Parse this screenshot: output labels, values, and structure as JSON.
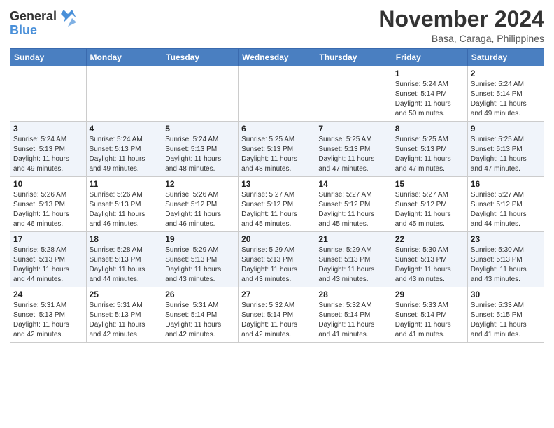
{
  "logo": {
    "line1": "General",
    "line2": "Blue"
  },
  "title": "November 2024",
  "location": "Basa, Caraga, Philippines",
  "days_of_week": [
    "Sunday",
    "Monday",
    "Tuesday",
    "Wednesday",
    "Thursday",
    "Friday",
    "Saturday"
  ],
  "weeks": [
    [
      {
        "day": "",
        "info": ""
      },
      {
        "day": "",
        "info": ""
      },
      {
        "day": "",
        "info": ""
      },
      {
        "day": "",
        "info": ""
      },
      {
        "day": "",
        "info": ""
      },
      {
        "day": "1",
        "info": "Sunrise: 5:24 AM\nSunset: 5:14 PM\nDaylight: 11 hours\nand 50 minutes."
      },
      {
        "day": "2",
        "info": "Sunrise: 5:24 AM\nSunset: 5:14 PM\nDaylight: 11 hours\nand 49 minutes."
      }
    ],
    [
      {
        "day": "3",
        "info": "Sunrise: 5:24 AM\nSunset: 5:13 PM\nDaylight: 11 hours\nand 49 minutes."
      },
      {
        "day": "4",
        "info": "Sunrise: 5:24 AM\nSunset: 5:13 PM\nDaylight: 11 hours\nand 49 minutes."
      },
      {
        "day": "5",
        "info": "Sunrise: 5:24 AM\nSunset: 5:13 PM\nDaylight: 11 hours\nand 48 minutes."
      },
      {
        "day": "6",
        "info": "Sunrise: 5:25 AM\nSunset: 5:13 PM\nDaylight: 11 hours\nand 48 minutes."
      },
      {
        "day": "7",
        "info": "Sunrise: 5:25 AM\nSunset: 5:13 PM\nDaylight: 11 hours\nand 47 minutes."
      },
      {
        "day": "8",
        "info": "Sunrise: 5:25 AM\nSunset: 5:13 PM\nDaylight: 11 hours\nand 47 minutes."
      },
      {
        "day": "9",
        "info": "Sunrise: 5:25 AM\nSunset: 5:13 PM\nDaylight: 11 hours\nand 47 minutes."
      }
    ],
    [
      {
        "day": "10",
        "info": "Sunrise: 5:26 AM\nSunset: 5:13 PM\nDaylight: 11 hours\nand 46 minutes."
      },
      {
        "day": "11",
        "info": "Sunrise: 5:26 AM\nSunset: 5:13 PM\nDaylight: 11 hours\nand 46 minutes."
      },
      {
        "day": "12",
        "info": "Sunrise: 5:26 AM\nSunset: 5:12 PM\nDaylight: 11 hours\nand 46 minutes."
      },
      {
        "day": "13",
        "info": "Sunrise: 5:27 AM\nSunset: 5:12 PM\nDaylight: 11 hours\nand 45 minutes."
      },
      {
        "day": "14",
        "info": "Sunrise: 5:27 AM\nSunset: 5:12 PM\nDaylight: 11 hours\nand 45 minutes."
      },
      {
        "day": "15",
        "info": "Sunrise: 5:27 AM\nSunset: 5:12 PM\nDaylight: 11 hours\nand 45 minutes."
      },
      {
        "day": "16",
        "info": "Sunrise: 5:27 AM\nSunset: 5:12 PM\nDaylight: 11 hours\nand 44 minutes."
      }
    ],
    [
      {
        "day": "17",
        "info": "Sunrise: 5:28 AM\nSunset: 5:13 PM\nDaylight: 11 hours\nand 44 minutes."
      },
      {
        "day": "18",
        "info": "Sunrise: 5:28 AM\nSunset: 5:13 PM\nDaylight: 11 hours\nand 44 minutes."
      },
      {
        "day": "19",
        "info": "Sunrise: 5:29 AM\nSunset: 5:13 PM\nDaylight: 11 hours\nand 43 minutes."
      },
      {
        "day": "20",
        "info": "Sunrise: 5:29 AM\nSunset: 5:13 PM\nDaylight: 11 hours\nand 43 minutes."
      },
      {
        "day": "21",
        "info": "Sunrise: 5:29 AM\nSunset: 5:13 PM\nDaylight: 11 hours\nand 43 minutes."
      },
      {
        "day": "22",
        "info": "Sunrise: 5:30 AM\nSunset: 5:13 PM\nDaylight: 11 hours\nand 43 minutes."
      },
      {
        "day": "23",
        "info": "Sunrise: 5:30 AM\nSunset: 5:13 PM\nDaylight: 11 hours\nand 43 minutes."
      }
    ],
    [
      {
        "day": "24",
        "info": "Sunrise: 5:31 AM\nSunset: 5:13 PM\nDaylight: 11 hours\nand 42 minutes."
      },
      {
        "day": "25",
        "info": "Sunrise: 5:31 AM\nSunset: 5:13 PM\nDaylight: 11 hours\nand 42 minutes."
      },
      {
        "day": "26",
        "info": "Sunrise: 5:31 AM\nSunset: 5:14 PM\nDaylight: 11 hours\nand 42 minutes."
      },
      {
        "day": "27",
        "info": "Sunrise: 5:32 AM\nSunset: 5:14 PM\nDaylight: 11 hours\nand 42 minutes."
      },
      {
        "day": "28",
        "info": "Sunrise: 5:32 AM\nSunset: 5:14 PM\nDaylight: 11 hours\nand 41 minutes."
      },
      {
        "day": "29",
        "info": "Sunrise: 5:33 AM\nSunset: 5:14 PM\nDaylight: 11 hours\nand 41 minutes."
      },
      {
        "day": "30",
        "info": "Sunrise: 5:33 AM\nSunset: 5:15 PM\nDaylight: 11 hours\nand 41 minutes."
      }
    ]
  ]
}
